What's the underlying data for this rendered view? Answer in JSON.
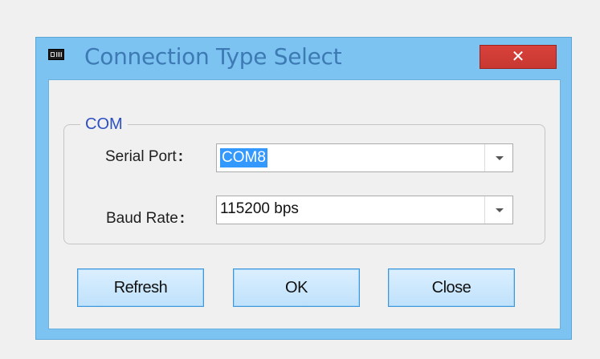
{
  "window": {
    "title": "Connection Type Select",
    "close_glyph": "✕",
    "app_icon": "terminal-icon",
    "colors": {
      "frame": "#7cc3f1",
      "title_text": "#3d7ab4",
      "close_button": "#c73830",
      "group_title": "#2d4fc0",
      "selection": "#3399ff"
    }
  },
  "group": {
    "title": "COM"
  },
  "fields": {
    "serial_port": {
      "label": "Serial Port",
      "colon": ":",
      "value": "COM8"
    },
    "baud_rate": {
      "label": "Baud Rate",
      "colon": ":",
      "value": "115200 bps"
    }
  },
  "buttons": {
    "refresh": "Refresh",
    "ok": "OK",
    "close": "Close"
  }
}
